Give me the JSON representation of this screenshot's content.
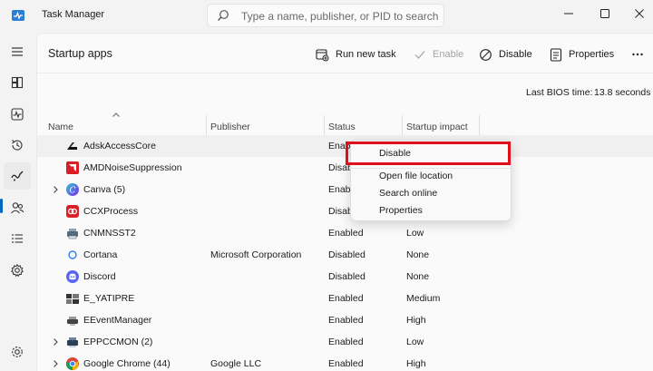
{
  "window": {
    "title": "Task Manager"
  },
  "search": {
    "placeholder": "Type a name, publisher, or PID to search"
  },
  "page": {
    "title": "Startup apps"
  },
  "toolbar": {
    "run_new_task": "Run new task",
    "enable": "Enable",
    "disable": "Disable",
    "properties": "Properties"
  },
  "bios": {
    "label": "Last BIOS time:",
    "value": "13.8 seconds"
  },
  "columns": {
    "name": "Name",
    "publisher": "Publisher",
    "status": "Status",
    "impact": "Startup impact"
  },
  "rows": [
    {
      "name": "AdskAccessCore",
      "publisher": "",
      "status": "Enabled",
      "impact": "",
      "expandable": false,
      "icon": "autodesk-icon"
    },
    {
      "name": "AMDNoiseSuppression",
      "publisher": "",
      "status": "Disabled",
      "impact": "",
      "expandable": false,
      "icon": "amd-icon"
    },
    {
      "name": "Canva (5)",
      "publisher": "",
      "status": "Enabled",
      "impact": "",
      "expandable": true,
      "icon": "canva-icon"
    },
    {
      "name": "CCXProcess",
      "publisher": "",
      "status": "Disabled",
      "impact": "",
      "expandable": false,
      "icon": "adobe-cc-icon"
    },
    {
      "name": "CNMNSST2",
      "publisher": "",
      "status": "Enabled",
      "impact": "Low",
      "expandable": false,
      "icon": "canon-icon"
    },
    {
      "name": "Cortana",
      "publisher": "Microsoft Corporation",
      "status": "Disabled",
      "impact": "None",
      "expandable": false,
      "icon": "cortana-icon"
    },
    {
      "name": "Discord",
      "publisher": "",
      "status": "Disabled",
      "impact": "None",
      "expandable": false,
      "icon": "discord-icon"
    },
    {
      "name": "E_YATIPRE",
      "publisher": "",
      "status": "Enabled",
      "impact": "Medium",
      "expandable": false,
      "icon": "epson-icon"
    },
    {
      "name": "EEventManager",
      "publisher": "",
      "status": "Enabled",
      "impact": "High",
      "expandable": false,
      "icon": "epson-event-icon"
    },
    {
      "name": "EPPCCMON (2)",
      "publisher": "",
      "status": "Enabled",
      "impact": "Low",
      "expandable": true,
      "icon": "epson-monitor-icon"
    },
    {
      "name": "Google Chrome (44)",
      "publisher": "Google LLC",
      "status": "Enabled",
      "impact": "High",
      "expandable": true,
      "icon": "chrome-icon"
    }
  ],
  "context_menu": {
    "items": [
      "Disable",
      "Open file location",
      "Search online",
      "Properties"
    ],
    "highlighted": "Disable",
    "highlight_color": "#e0101b"
  },
  "colors": {
    "accent": "#0067c0",
    "background": "#f3f3f3",
    "panel": "#fafafa"
  }
}
